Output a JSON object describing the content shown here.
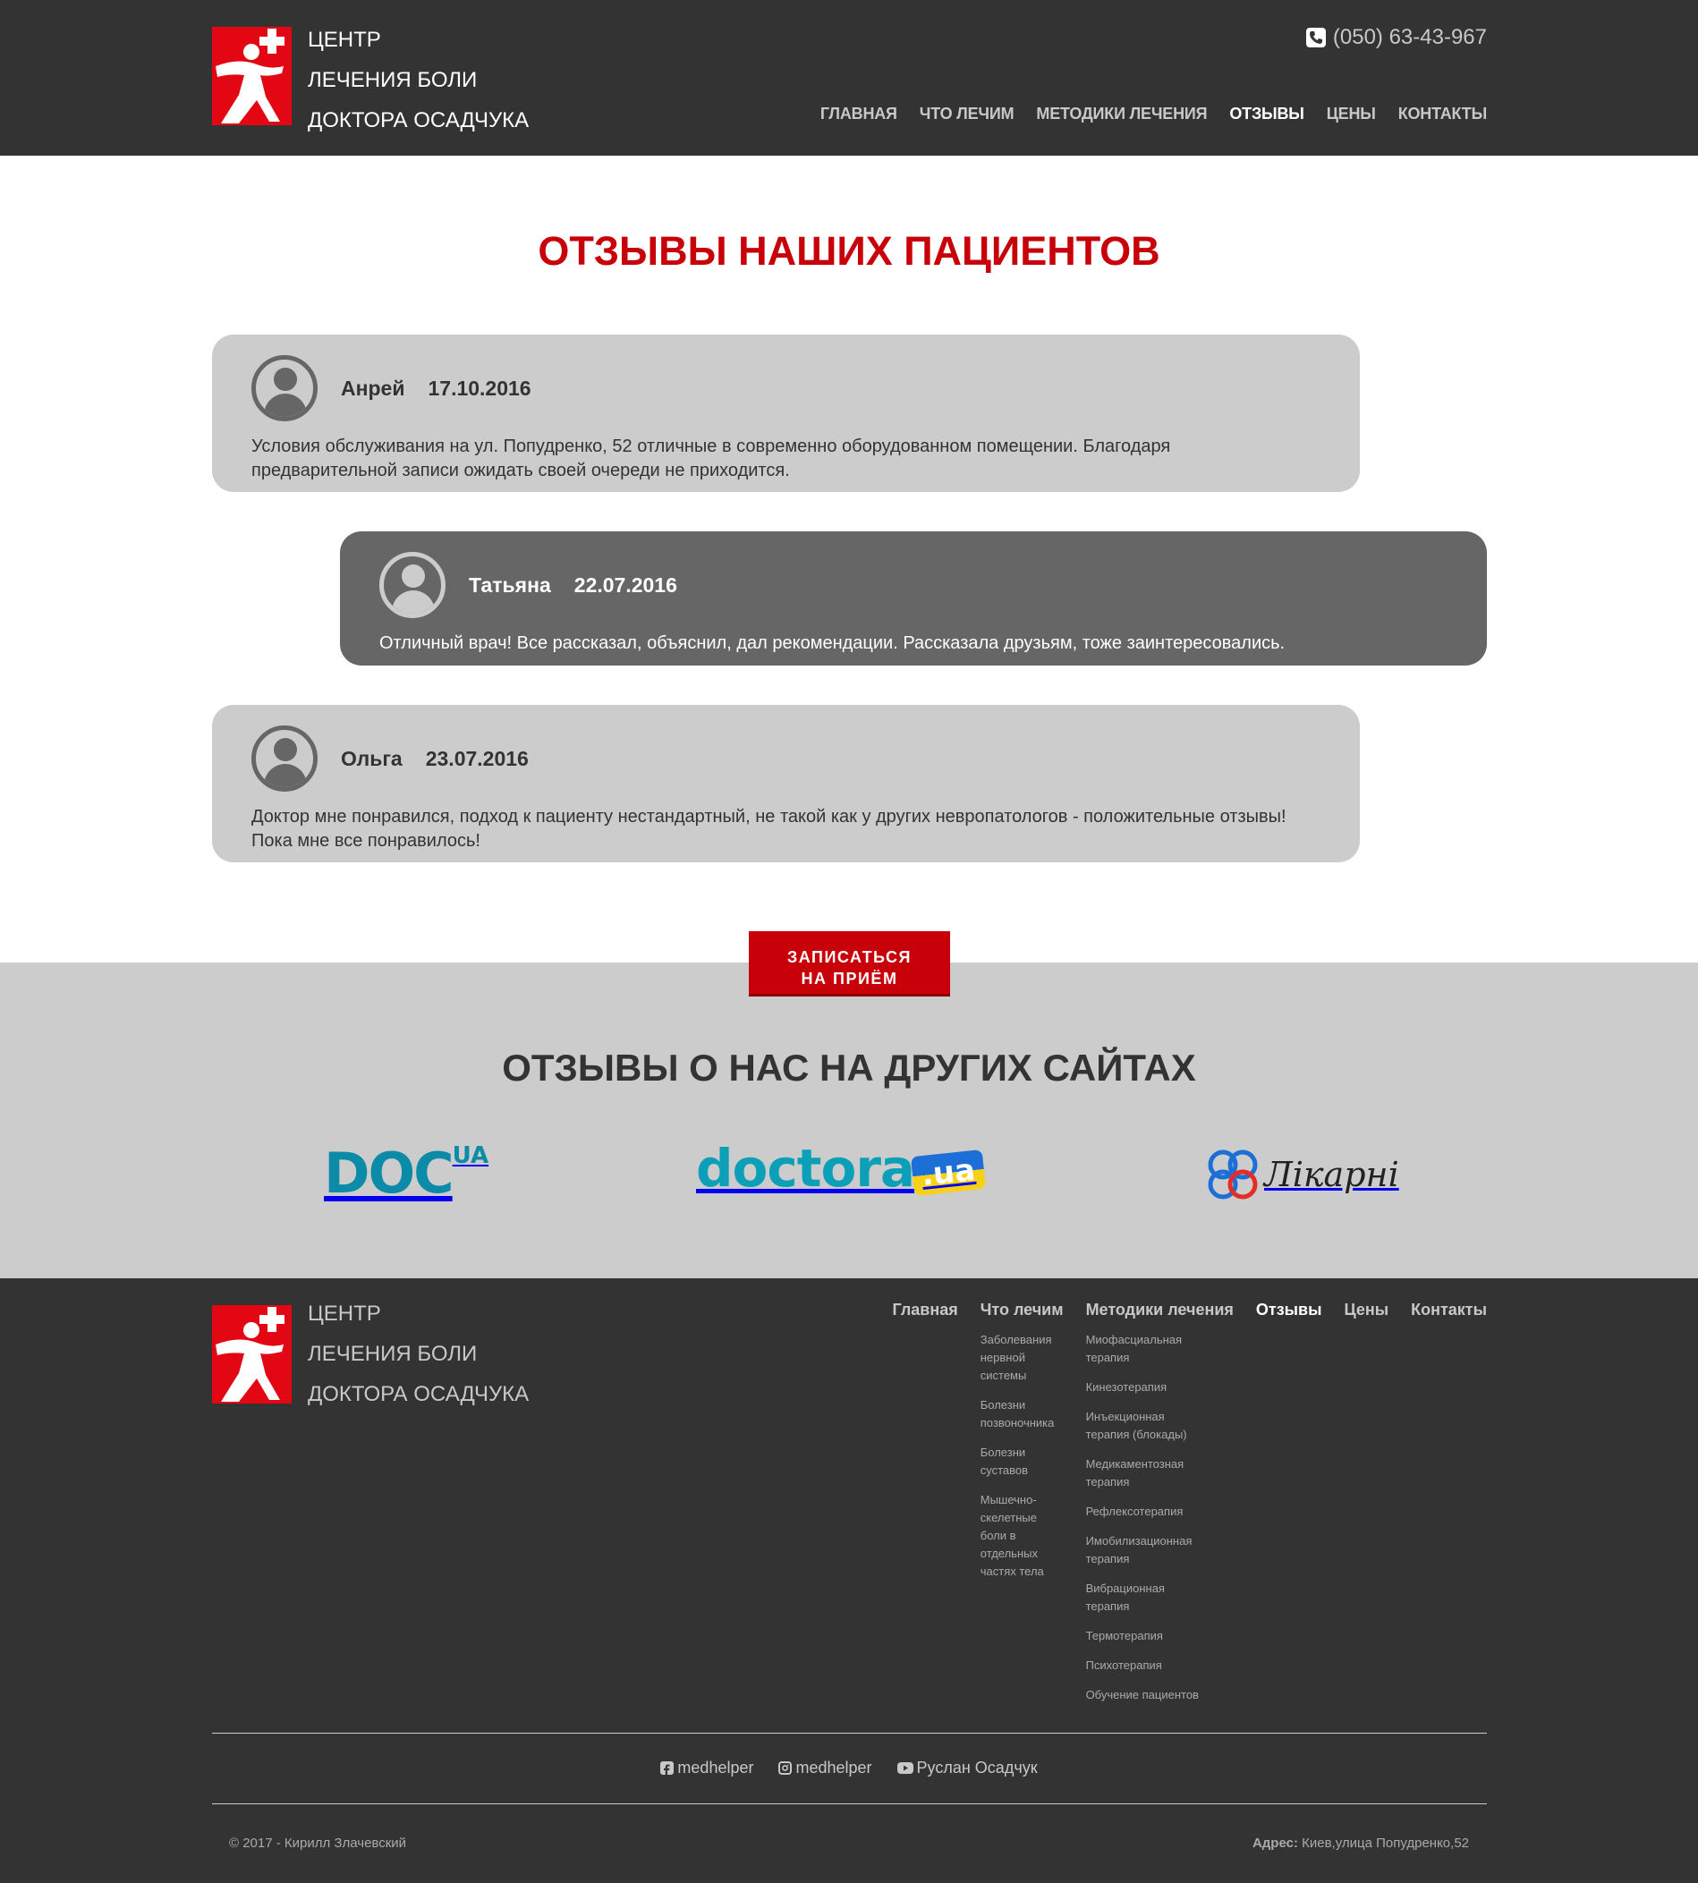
{
  "header": {
    "brand_lines": [
      "ЦЕНТР",
      "ЛЕЧЕНИЯ БОЛИ",
      "ДОКТОРА ОСАДЧУКА"
    ],
    "phone": "(050) 63-43-967",
    "nav": [
      {
        "label": "ГЛАВНАЯ",
        "active": false
      },
      {
        "label": "ЧТО ЛЕЧИМ",
        "active": false
      },
      {
        "label": "МЕТОДИКИ ЛЕЧЕНИЯ",
        "active": false
      },
      {
        "label": "ОТЗЫВЫ",
        "active": true
      },
      {
        "label": "ЦЕНЫ",
        "active": false
      },
      {
        "label": "КОНТАКТЫ",
        "active": false
      }
    ]
  },
  "main": {
    "title": "ОТЗЫВЫ НАШИХ ПАЦИЕНТОВ",
    "reviews": [
      {
        "name": "Анрей",
        "date": "17.10.2016",
        "text": "Условия обслуживания на ул. Попудренко, 52 отличные в современно оборудованном помещении. Благодаря предварительной записи ожидать своей очереди не приходится."
      },
      {
        "name": "Татьяна",
        "date": "22.07.2016",
        "text": "Отличный врач! Все рассказал, объяснил, дал рекомендации. Рассказала друзьям, тоже заинтересовались."
      },
      {
        "name": "Ольга",
        "date": "23.07.2016",
        "text": "Доктор мне понравился, подход к пациенту нестандартный, не такой как у других невропатологов - положительные отзывы! Пока мне все понравилось!"
      }
    ],
    "cta_lines": [
      "ЗАПИСАТЬСЯ",
      "НА ПРИЁМ"
    ]
  },
  "other_sites": {
    "title": "ОТЗЫВЫ О НАС НА ДРУГИХ САЙТАХ",
    "sites": [
      {
        "logo_text": "DOC",
        "logo_sup": "UA"
      },
      {
        "logo_text": "doctora",
        "logo_sup": ".ua"
      },
      {
        "logo_text": "Лікарні"
      }
    ],
    "colors": {
      "teal": "#0b8ba8",
      "blue": "#1b6fd6",
      "red": "#e52d27",
      "yellow": "#f7d117"
    }
  },
  "footer": {
    "brand_lines": [
      "ЦЕНТР",
      "ЛЕЧЕНИЯ БОЛИ",
      "ДОКТОРА ОСАДЧУКА"
    ],
    "nav": [
      {
        "label": "Главная",
        "active": false,
        "sub": []
      },
      {
        "label": "Что лечим",
        "active": false,
        "sub": [
          "Заболевания нервной системы",
          "Болезни позвоночника",
          "Болезни суставов",
          "Мышечно-скелетные боли в отдельных частях тела"
        ]
      },
      {
        "label": "Методики лечения",
        "active": false,
        "sub": [
          "Миофасциальная терапия",
          "Кинезотерапия",
          "Инъекционная терапия (блокады)",
          "Медикаментозная терапия",
          "Рефлексотерапия",
          "Имобилизационная терапия",
          "Вибрационная терапия",
          "Термотерапия",
          "Психотерапия",
          "Обучение пациентов"
        ]
      },
      {
        "label": "Отзывы",
        "active": true,
        "sub": []
      },
      {
        "label": "Цены",
        "active": false,
        "sub": []
      },
      {
        "label": "Контакты",
        "active": false,
        "sub": []
      }
    ],
    "social": [
      {
        "icon": "facebook-icon",
        "label": "medhelper"
      },
      {
        "icon": "instagram-icon",
        "label": "medhelper"
      },
      {
        "icon": "youtube-icon",
        "label": "Руслан Осадчук"
      }
    ],
    "copyright": "© 2017 - Кирилл Злачевский",
    "address_label": "Адрес:",
    "address_value": " Киев,улица Попудренко,52"
  },
  "colors": {
    "accent": "#c8000a",
    "logo_red": "#e30613",
    "dark_bg": "#333333",
    "light_gray": "#cccccc",
    "mid_gray": "#666666"
  }
}
